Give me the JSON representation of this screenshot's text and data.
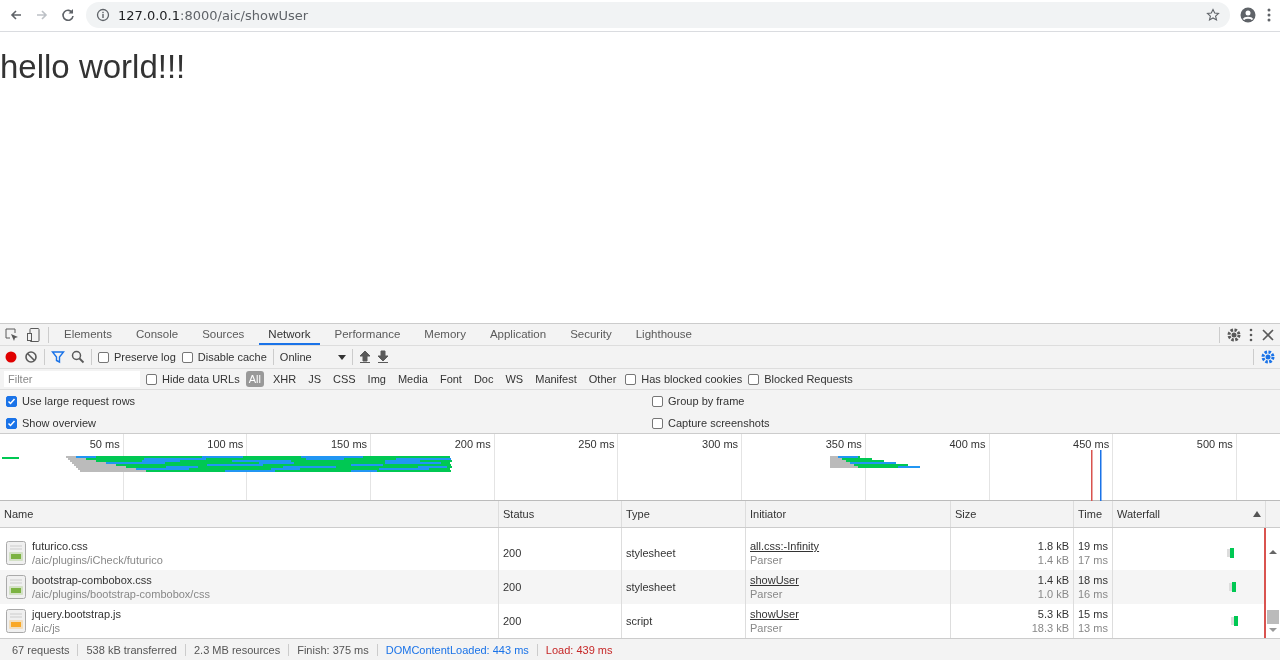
{
  "browser": {
    "url_host": "127.0.0.1",
    "url_rest": ":8000/aic/showUser"
  },
  "page": {
    "heading": "hello world!!!"
  },
  "devtools": {
    "tabs": [
      {
        "label": "Elements",
        "selected": false
      },
      {
        "label": "Console",
        "selected": false
      },
      {
        "label": "Sources",
        "selected": false
      },
      {
        "label": "Network",
        "selected": true
      },
      {
        "label": "Performance",
        "selected": false
      },
      {
        "label": "Memory",
        "selected": false
      },
      {
        "label": "Application",
        "selected": false
      },
      {
        "label": "Security",
        "selected": false
      },
      {
        "label": "Lighthouse",
        "selected": false
      }
    ],
    "toolbar": {
      "recording": true,
      "preserve_log": {
        "label": "Preserve log",
        "checked": false
      },
      "disable_cache": {
        "label": "Disable cache",
        "checked": false
      },
      "throttling": "Online"
    },
    "filter": {
      "placeholder": "Filter",
      "hide_data_urls": {
        "label": "Hide data URLs",
        "checked": false
      },
      "types": [
        {
          "label": "All",
          "selected": true
        },
        {
          "label": "XHR",
          "selected": false
        },
        {
          "label": "JS",
          "selected": false
        },
        {
          "label": "CSS",
          "selected": false
        },
        {
          "label": "Img",
          "selected": false
        },
        {
          "label": "Media",
          "selected": false
        },
        {
          "label": "Font",
          "selected": false
        },
        {
          "label": "Doc",
          "selected": false
        },
        {
          "label": "WS",
          "selected": false
        },
        {
          "label": "Manifest",
          "selected": false
        },
        {
          "label": "Other",
          "selected": false
        }
      ],
      "has_blocked_cookies": {
        "label": "Has blocked cookies",
        "checked": false
      },
      "blocked_requests": {
        "label": "Blocked Requests",
        "checked": false
      }
    },
    "options": [
      {
        "label": "Use large request rows",
        "checked": true
      },
      {
        "label": "Group by frame",
        "checked": false
      },
      {
        "label": "Show overview",
        "checked": true
      },
      {
        "label": "Capture screenshots",
        "checked": false
      }
    ],
    "overview": {
      "ticks": [
        "50 ms",
        "100 ms",
        "150 ms",
        "200 ms",
        "250 ms",
        "300 ms",
        "350 ms",
        "400 ms",
        "450 ms",
        "500 ms"
      ]
    },
    "table": {
      "columns": [
        "Name",
        "Status",
        "Type",
        "Initiator",
        "Size",
        "Time",
        "Waterfall"
      ],
      "rows": [
        {
          "name": "futurico.css",
          "path": "/aic/plugins/iCheck/futurico",
          "kind": "css",
          "status": "200",
          "type": "stylesheet",
          "initiator": "all.css:-Infinity",
          "initiator_sub": "Parser",
          "size": "1.8 kB",
          "size_sub": "1.4 kB",
          "time": "19 ms",
          "time_sub": "17 ms"
        },
        {
          "name": "bootstrap-combobox.css",
          "path": "/aic/plugins/bootstrap-combobox/css",
          "kind": "css",
          "status": "200",
          "type": "stylesheet",
          "initiator": "showUser",
          "initiator_sub": "Parser",
          "size": "1.4 kB",
          "size_sub": "1.0 kB",
          "time": "18 ms",
          "time_sub": "16 ms"
        },
        {
          "name": "jquery.bootstrap.js",
          "path": "/aic/js",
          "kind": "js",
          "status": "200",
          "type": "script",
          "initiator": "showUser",
          "initiator_sub": "Parser",
          "size": "5.3 kB",
          "size_sub": "18.3 kB",
          "time": "15 ms",
          "time_sub": "13 ms"
        }
      ]
    },
    "status_bar": [
      {
        "text": "67 requests",
        "kind": "plain"
      },
      {
        "text": "538 kB transferred",
        "kind": "plain"
      },
      {
        "text": "2.3 MB resources",
        "kind": "plain"
      },
      {
        "text": "Finish: 375 ms",
        "kind": "plain"
      },
      {
        "text": "DOMContentLoaded: 443 ms",
        "kind": "dom"
      },
      {
        "text": "Load: 439 ms",
        "kind": "load"
      }
    ]
  }
}
